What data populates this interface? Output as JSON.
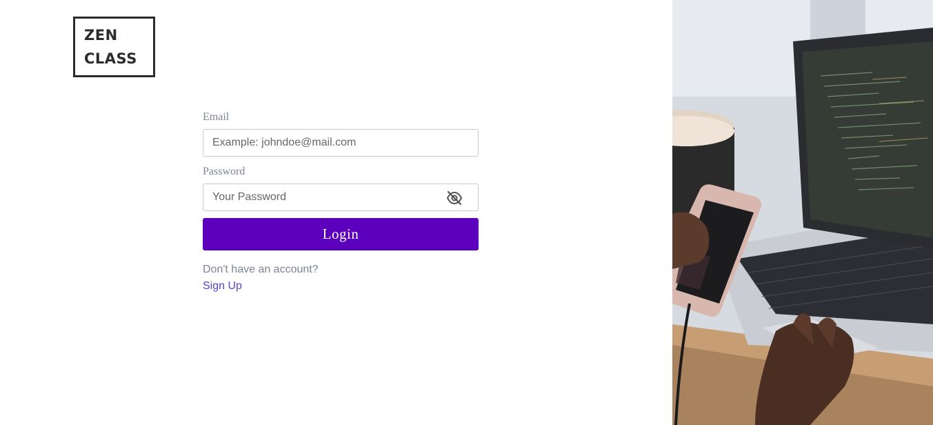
{
  "brand": {
    "logo_line1": "ZEN",
    "logo_line2": "CLASS"
  },
  "form": {
    "email_label": "Email",
    "email_placeholder": "Example: johndoe@mail.com",
    "email_value": "",
    "password_label": "Password",
    "password_placeholder": "Your Password",
    "password_value": "",
    "password_toggle_icon": "eye-off-icon",
    "login_label": "Login",
    "signup_prompt": "Don't have an account?",
    "signup_link": "Sign Up"
  },
  "colors": {
    "primary": "#5c00bd",
    "link": "#5b3fd0",
    "label": "#7c8593"
  },
  "hero_image": {
    "icon": "hero-photo-laptop-phone"
  }
}
